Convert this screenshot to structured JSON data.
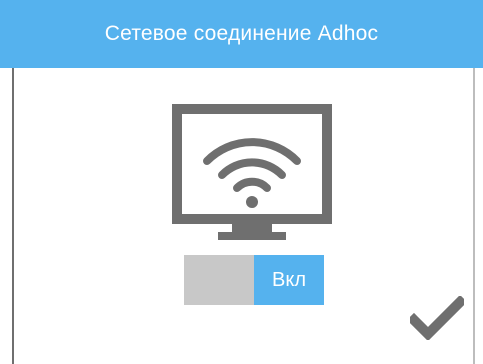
{
  "dialog": {
    "title": "Сетевое соединение Adhoc",
    "accent_color": "#55b2ee"
  },
  "illustration": {
    "icon": "monitor-wifi-icon"
  },
  "toggle": {
    "state_label": "Вкл",
    "is_on": true
  },
  "actions": {
    "confirm_icon": "checkmark-icon"
  }
}
